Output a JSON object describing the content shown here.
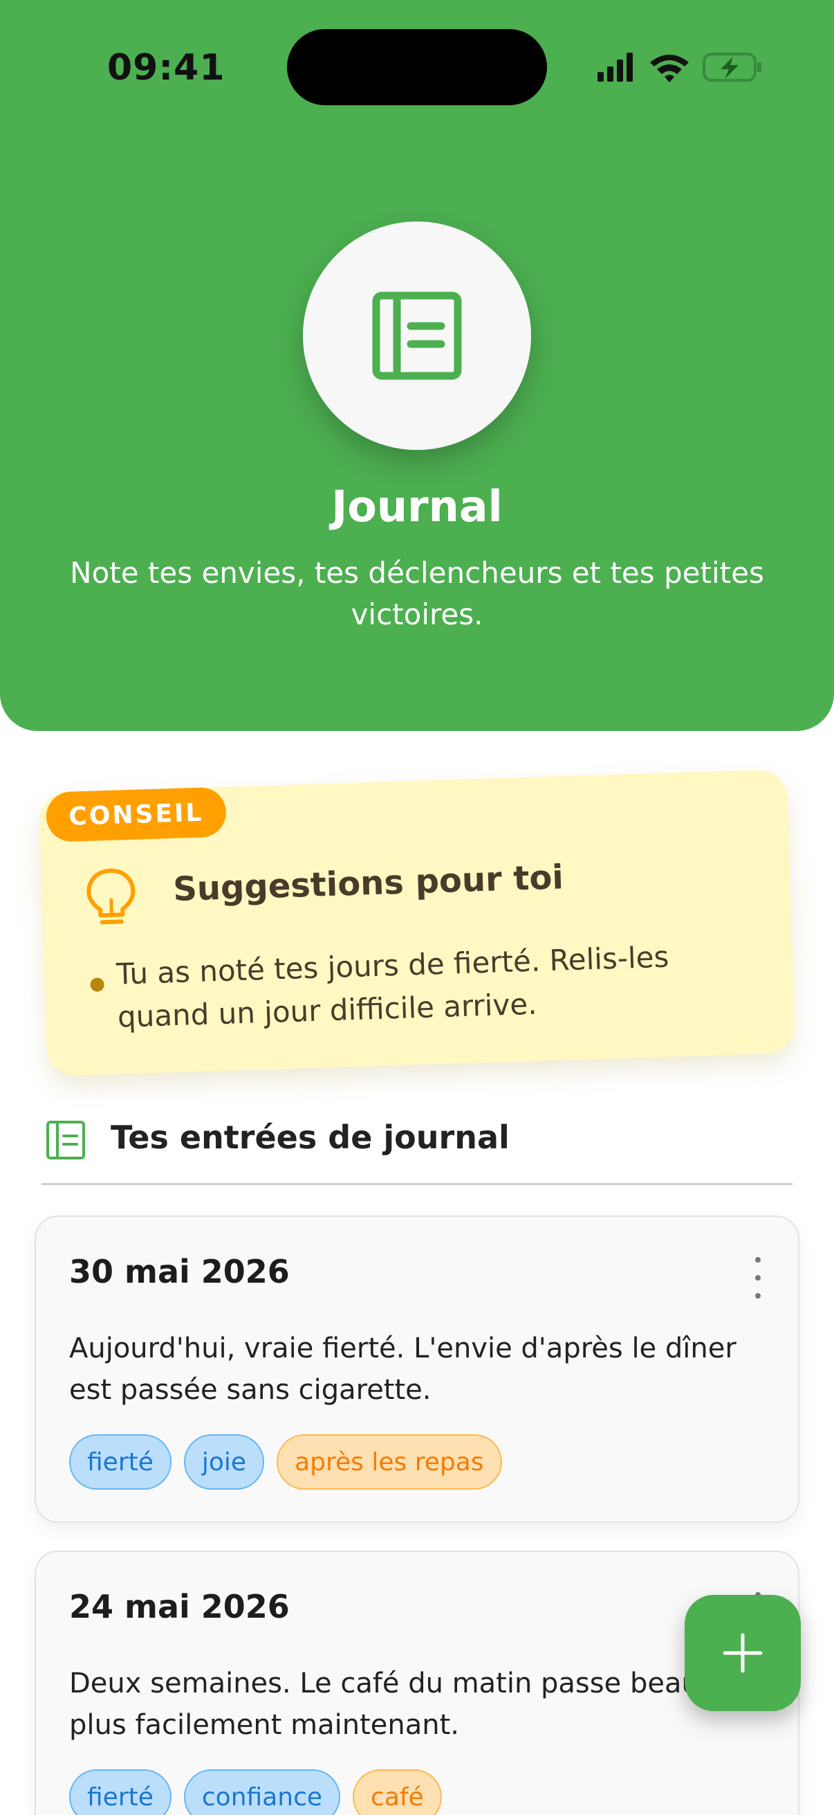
{
  "status_bar": {
    "time": "09:41",
    "icons": [
      "signal-icon",
      "wifi-icon",
      "battery-charging-icon"
    ]
  },
  "header": {
    "icon": "notebook-icon",
    "title": "Journal",
    "subtitle": "Note tes envies, tes déclencheurs et tes petites victoires."
  },
  "tip": {
    "badge": "CONSEIL",
    "icon": "lightbulb-icon",
    "title": "Suggestions pour toi",
    "items": [
      "Tu as noté tes jours de fierté. Relis-les quand un jour difficile arrive."
    ]
  },
  "section": {
    "icon": "notebook-icon",
    "title": "Tes entrées de journal"
  },
  "entries": [
    {
      "date": "30 mai 2026",
      "text": "Aujourd'hui, vraie fierté. L'envie d'après le dîner est passée sans cigarette.",
      "tags": [
        {
          "label": "fierté",
          "kind": "emotion"
        },
        {
          "label": "joie",
          "kind": "emotion"
        },
        {
          "label": "après les repas",
          "kind": "trigger"
        }
      ]
    },
    {
      "date": "24 mai 2026",
      "text": "Deux semaines. Le café du matin passe beaucoup plus facilement maintenant.",
      "tags": [
        {
          "label": "fierté",
          "kind": "emotion"
        },
        {
          "label": "confiance",
          "kind": "emotion"
        },
        {
          "label": "café",
          "kind": "trigger"
        }
      ]
    }
  ],
  "fab": {
    "icon": "plus-icon"
  },
  "colors": {
    "primary": "#4CAF50",
    "tip_background": "#FFF8C2",
    "tip_badge": "#FFA000",
    "emotion_tag": "#BBDEFB",
    "trigger_tag": "#FFE0B2"
  }
}
